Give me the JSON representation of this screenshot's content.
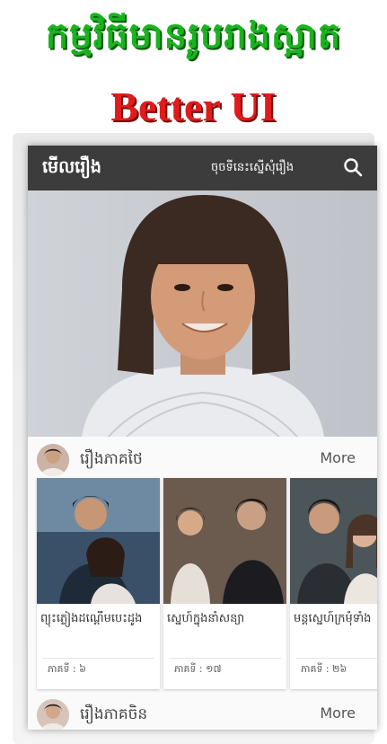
{
  "promo": {
    "title": "កម្មវិធីមានរូបរាងស្អាត",
    "subtitle": "Better UI"
  },
  "appbar": {
    "title": "មើលរឿង",
    "request_label": "ចុចទីនេះស្នើសុំរឿង",
    "search_icon": "search-icon"
  },
  "sections": [
    {
      "label": "រឿងភាគថៃ",
      "more_label": "More",
      "items": [
        {
          "title": "ព្យុះភ្លៀងដណ្ដើមបេះដូង",
          "eps": "ភាគទី : ៦"
        },
        {
          "title": "ស្នេហ៍ក្នុងនាំសន្យា",
          "eps": "ភាគទី : ១៧"
        },
        {
          "title": "មន្តស្នេហ៍ក្រមុំទាំង",
          "eps": "ភាគទី : ២៦"
        }
      ]
    },
    {
      "label": "រឿងភាគចិន",
      "more_label": "More"
    }
  ],
  "colors": {
    "promo_title": "#19b31e",
    "promo_subtitle": "#e01b1b",
    "appbar": "#3c3c3c"
  }
}
